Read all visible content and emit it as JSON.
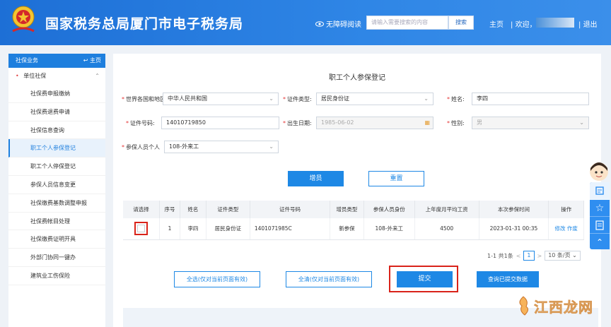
{
  "header": {
    "title": "国家税务总局厦门市电子税务局",
    "accessibility": "无障碍阅读",
    "search_placeholder": "请输入需要搜索的内容",
    "search_button": "搜索",
    "home": "主页",
    "welcome": "欢迎，",
    "logout": "退出"
  },
  "sidebar": {
    "header": "社保业务",
    "home_link": "主页",
    "group": "单位社保",
    "items": [
      "社保费申报缴纳",
      "社保费退费申请",
      "社保信息查询",
      "职工个人参保登记",
      "职工个人停保登记",
      "参保人员信息变更",
      "社保缴费基数调整申报",
      "社保费帐目处理",
      "社保缴费证明开具",
      "外部门协同一键办",
      "建筑业工伤保险"
    ],
    "active_index": 3
  },
  "form": {
    "heading": "职工个人参保登记",
    "country_label": "世界各国和地区",
    "country_value": "中华人民共和国",
    "id_type_label": "证件类型:",
    "id_type_value": "居民身份证",
    "name_label": "姓名:",
    "name_value": "李四",
    "id_no_label": "证件号码:",
    "id_no_value": "14010719850",
    "birth_label": "出生日期:",
    "birth_value": "1985-06-02",
    "gender_label": "性别:",
    "gender_value": "男",
    "insured_type_label": "参保人员个人",
    "insured_type_value": "108-外来工",
    "add_button": "增员",
    "reset_button": "重置"
  },
  "table": {
    "headers": [
      "请选择",
      "序号",
      "姓名",
      "证件类型",
      "证件号码",
      "增员类型",
      "参保人员身份",
      "上年度月平均工资",
      "本次参保时间",
      "操作"
    ],
    "rows": [
      {
        "seq": "1",
        "name": "李四",
        "id_type": "居民身份证",
        "id_no": "1401071985C",
        "add_type": "新参保",
        "identity": "108-外来工",
        "avg_wage": "4500",
        "time": "2023-01-31 00:35",
        "edit": "修改",
        "void": "作废"
      }
    ]
  },
  "pager": {
    "summary": "1-1 共1条",
    "prev": "<",
    "page": "1",
    "next": ">",
    "size": "10 条/页"
  },
  "actions": {
    "select_all": "全选(仅对当前页面有效)",
    "clear_all": "全清(仅对当前页面有效)",
    "submit": "提交",
    "query": "查询已提交数据"
  },
  "watermark": "江西龙网",
  "colors": {
    "primary": "#1e88e5",
    "header": "#2f86e6",
    "highlight": "#d9231a"
  }
}
